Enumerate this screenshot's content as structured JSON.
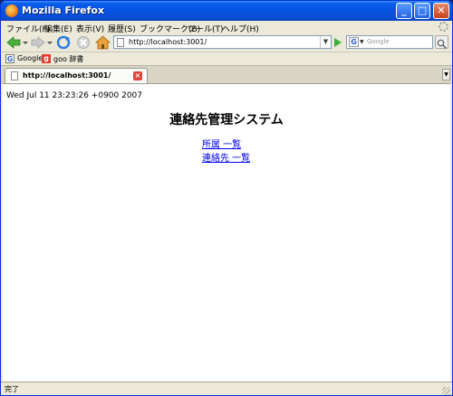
{
  "window": {
    "title": "Mozilla Firefox"
  },
  "menu": {
    "items": [
      "ファイル(F)",
      "編集(E)",
      "表示(V)",
      "履歴(S)",
      "ブックマーク(B)",
      "ツール(T)",
      "ヘルプ(H)"
    ]
  },
  "toolbar": {
    "url": "http://localhost:3001/",
    "search_placeholder": "Google",
    "search_engine": "G"
  },
  "bookmarks": [
    {
      "icon": "G",
      "label": "Google"
    },
    {
      "icon": "g",
      "label": "goo 辞書"
    }
  ],
  "tab": {
    "title": "http://localhost:3001/"
  },
  "page": {
    "timestamp": "Wed Jul 11 23:23:26 +0900 2007",
    "heading": "連絡先管理システム",
    "links": [
      "所属 一覧",
      "連絡先 一覧"
    ]
  },
  "status": {
    "text": "完了"
  },
  "colors": {
    "titlebar": "#0a5ee8",
    "link": "#0000ee",
    "chrome": "#ece9d8"
  }
}
